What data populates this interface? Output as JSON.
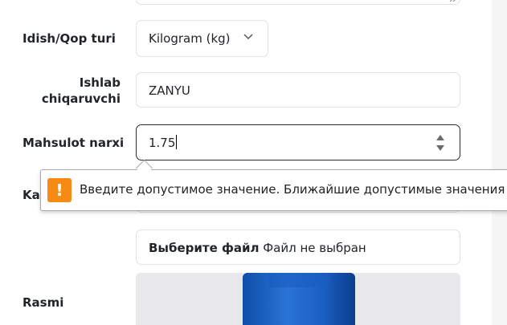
{
  "form": {
    "container_type": {
      "label": "Idish/Qop turi",
      "selected": "Kilogram (kg)"
    },
    "manufacturer": {
      "label": "Ishlab chiqaruvchi",
      "value": "ZANYU"
    },
    "price": {
      "label": "Mahsulot narxi",
      "value": "1.75"
    },
    "category": {
      "label_partial": "Ka"
    },
    "file": {
      "button_label": "Выберите файл",
      "status": "Файл не выбран"
    },
    "image": {
      "label": "Rasmi"
    }
  },
  "validation_tooltip": {
    "icon": "warning-icon",
    "icon_glyph": "!",
    "message": "Введите допустимое значение. Ближайшие допустимые значения",
    "color": "#f68a12"
  },
  "colors": {
    "border": "#dee2e6",
    "focus_border": "#2b2b2b",
    "product_blue": "#1c5fc3"
  }
}
